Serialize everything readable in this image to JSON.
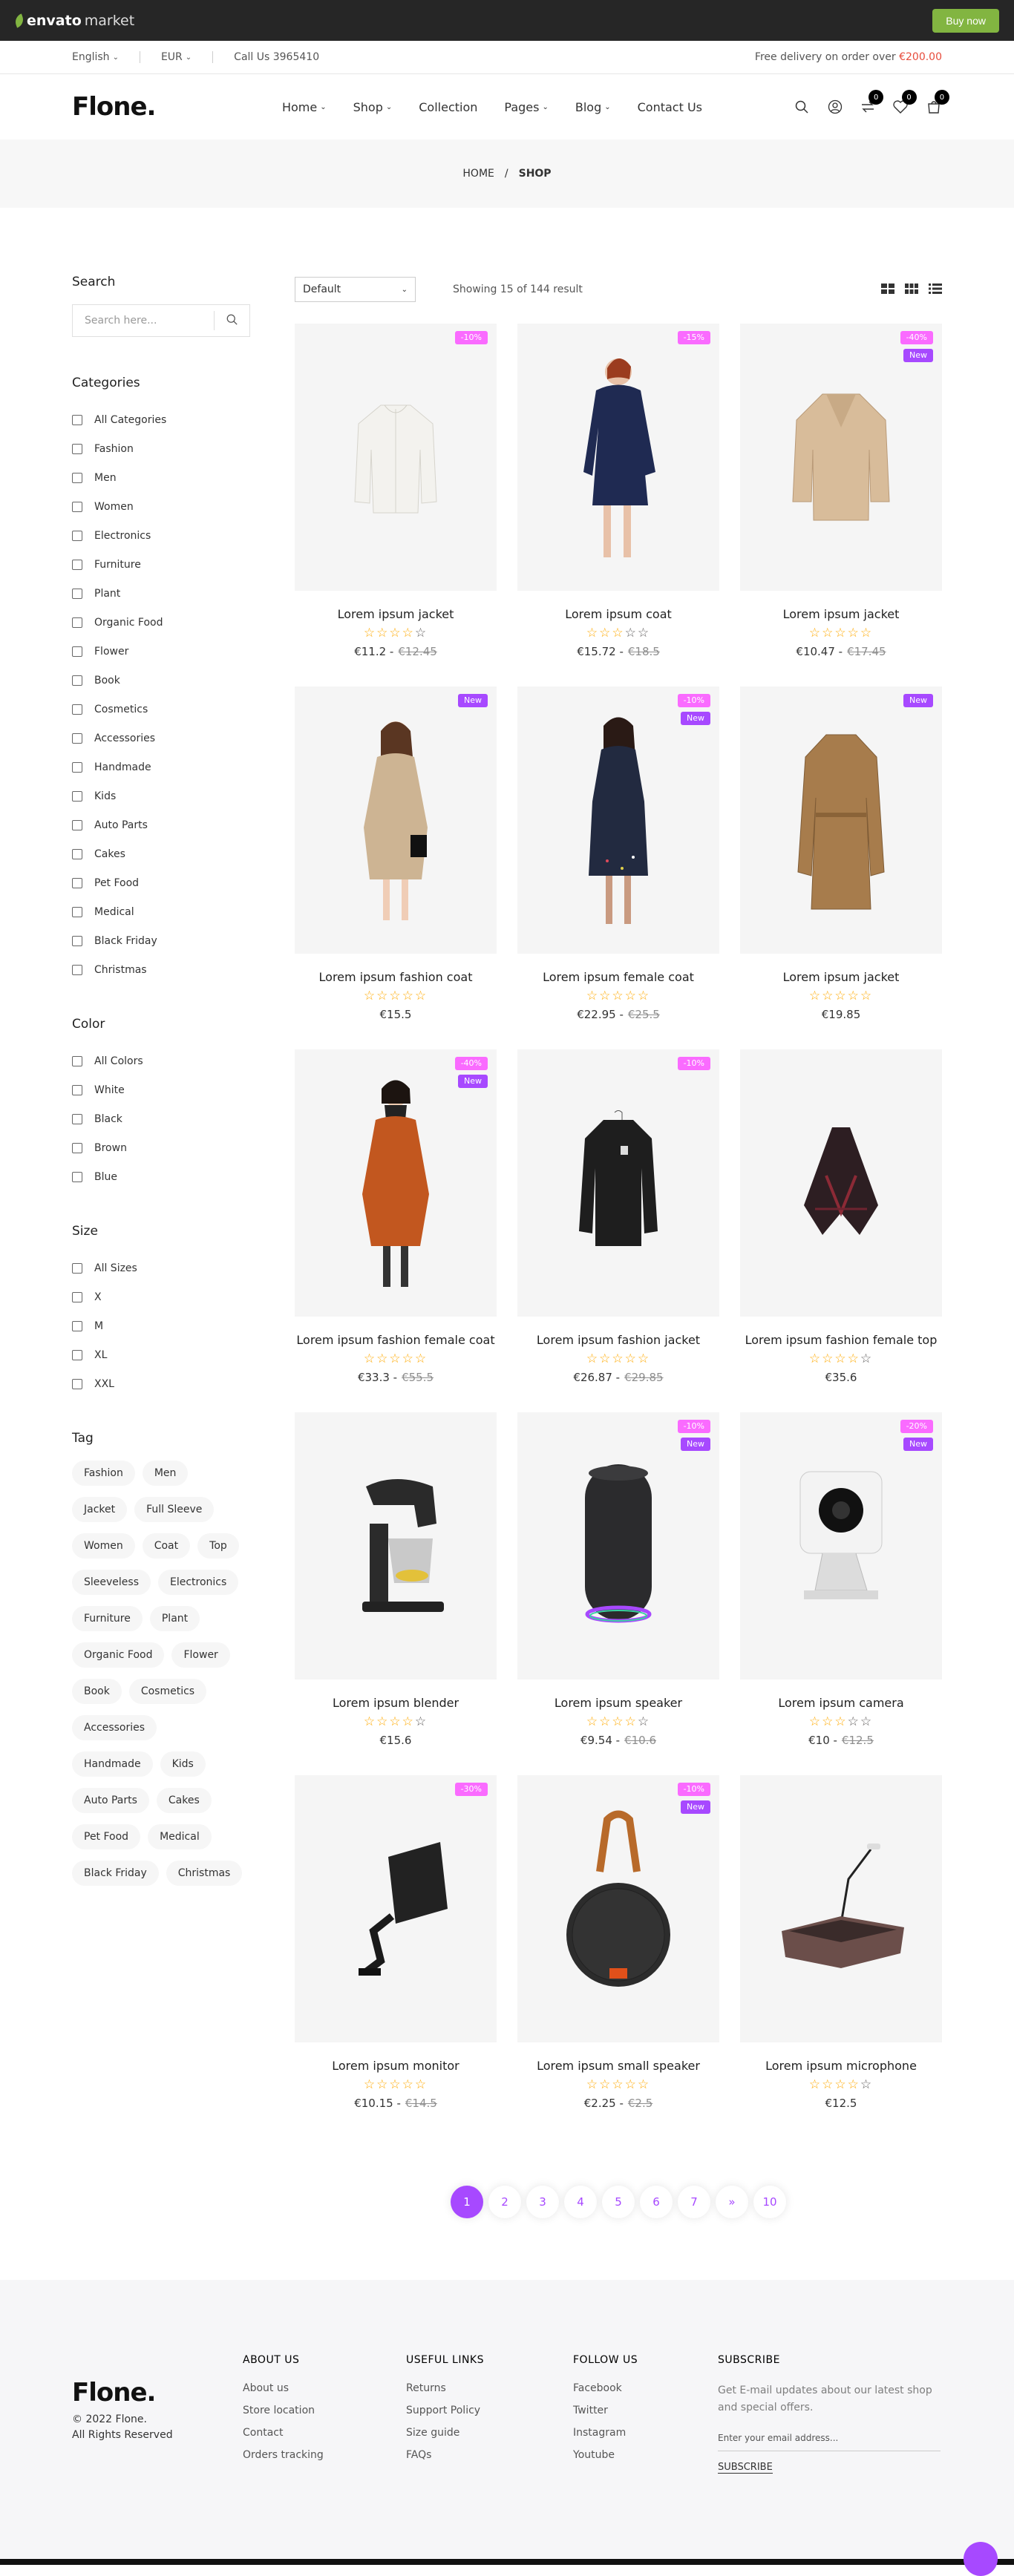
{
  "envato": {
    "logo_a": "envato",
    "logo_b": "market",
    "buy": "Buy now"
  },
  "topbar": {
    "language": "English",
    "currency": "EUR",
    "call": "Call Us 3965410",
    "delivery": "Free delivery on order over ",
    "delivery_amount": "€200.00"
  },
  "header": {
    "logo": "Flone.",
    "nav": [
      "Home",
      "Shop",
      "Collection",
      "Pages",
      "Blog",
      "Contact Us"
    ],
    "compare_count": "0",
    "wishlist_count": "0",
    "cart_count": "0"
  },
  "breadcrumb": {
    "home": "HOME",
    "sep": "/",
    "current": "SHOP"
  },
  "sidebar": {
    "search_title": "Search",
    "search_placeholder": "Search here...",
    "categories_title": "Categories",
    "categories": [
      "All Categories",
      "Fashion",
      "Men",
      "Women",
      "Electronics",
      "Furniture",
      "Plant",
      "Organic Food",
      "Flower",
      "Book",
      "Cosmetics",
      "Accessories",
      "Handmade",
      "Kids",
      "Auto Parts",
      "Cakes",
      "Pet Food",
      "Medical",
      "Black Friday",
      "Christmas"
    ],
    "color_title": "Color",
    "colors": [
      "All Colors",
      "White",
      "Black",
      "Brown",
      "Blue"
    ],
    "size_title": "Size",
    "sizes": [
      "All Sizes",
      "X",
      "M",
      "XL",
      "XXL"
    ],
    "tag_title": "Tag",
    "tags": [
      "Fashion",
      "Men",
      "Jacket",
      "Full Sleeve",
      "Women",
      "Coat",
      "Top",
      "Sleeveless",
      "Electronics",
      "Furniture",
      "Plant",
      "Organic Food",
      "Flower",
      "Book",
      "Cosmetics",
      "Accessories",
      "Handmade",
      "Kids",
      "Auto Parts",
      "Cakes",
      "Pet Food",
      "Medical",
      "Black Friday",
      "Christmas"
    ]
  },
  "toolbar": {
    "sort": "Default",
    "showing": "Showing 15 of 144 result"
  },
  "products": [
    {
      "name": "Lorem ipsum jacket",
      "rating": 4,
      "price": "€11.2 -",
      "old": "€12.45",
      "discount": "-10%",
      "new": false,
      "img": "white-jacket"
    },
    {
      "name": "Lorem ipsum coat",
      "rating": 3,
      "price": "€15.72 -",
      "old": "€18.5",
      "discount": "-15%",
      "new": false,
      "img": "navy-coat"
    },
    {
      "name": "Lorem ipsum jacket",
      "rating": 5,
      "price": "€10.47 -",
      "old": "€17.45",
      "discount": "-40%",
      "new": true,
      "img": "beige-coat"
    },
    {
      "name": "Lorem ipsum fashion coat",
      "rating": 5,
      "price": "€15.5",
      "old": "",
      "discount": "",
      "new": true,
      "img": "trench-woman"
    },
    {
      "name": "Lorem ipsum female coat",
      "rating": 5,
      "price": "€22.95 -",
      "old": "€25.5",
      "discount": "-10%",
      "new": true,
      "img": "black-dress"
    },
    {
      "name": "Lorem ipsum jacket",
      "rating": 5,
      "price": "€19.85",
      "old": "",
      "discount": "",
      "new": true,
      "img": "trench-coat"
    },
    {
      "name": "Lorem ipsum fashion female coat",
      "rating": 5,
      "price": "€33.3 -",
      "old": "€55.5",
      "discount": "-40%",
      "new": true,
      "img": "orange-coat"
    },
    {
      "name": "Lorem ipsum fashion jacket",
      "rating": 5,
      "price": "€26.87 -",
      "old": "€29.85",
      "discount": "-10%",
      "new": false,
      "img": "black-jacket"
    },
    {
      "name": "Lorem ipsum fashion female top",
      "rating": 4,
      "price": "€35.6",
      "old": "",
      "discount": "",
      "new": false,
      "img": "poncho"
    },
    {
      "name": "Lorem ipsum blender",
      "rating": 4,
      "price": "€15.6",
      "old": "",
      "discount": "",
      "new": false,
      "img": "blender"
    },
    {
      "name": "Lorem ipsum speaker",
      "rating": 4,
      "price": "€9.54 -",
      "old": "€10.6",
      "discount": "-10%",
      "new": true,
      "img": "speaker"
    },
    {
      "name": "Lorem ipsum camera",
      "rating": 3,
      "price": "€10 -",
      "old": "€12.5",
      "discount": "-20%",
      "new": true,
      "img": "camera"
    },
    {
      "name": "Lorem ipsum monitor",
      "rating": 5,
      "price": "€10.15 -",
      "old": "€14.5",
      "discount": "-30%",
      "new": false,
      "img": "monitor"
    },
    {
      "name": "Lorem ipsum small speaker",
      "rating": 5,
      "price": "€2.25 -",
      "old": "€2.5",
      "discount": "-10%",
      "new": true,
      "img": "small-speaker"
    },
    {
      "name": "Lorem ipsum microphone",
      "rating": 4,
      "price": "€12.5",
      "old": "",
      "discount": "",
      "new": false,
      "img": "microphone"
    }
  ],
  "new_label": "New",
  "pagination": [
    "1",
    "2",
    "3",
    "4",
    "5",
    "6",
    "7",
    "»",
    "10"
  ],
  "footer": {
    "logo": "Flone.",
    "copy1": "© 2022 Flone.",
    "copy2": "All Rights Reserved",
    "about_title": "ABOUT US",
    "about": [
      "About us",
      "Store location",
      "Contact",
      "Orders tracking"
    ],
    "useful_title": "USEFUL LINKS",
    "useful": [
      "Returns",
      "Support Policy",
      "Size guide",
      "FAQs"
    ],
    "follow_title": "FOLLOW US",
    "follow": [
      "Facebook",
      "Twitter",
      "Instagram",
      "Youtube"
    ],
    "sub_title": "SUBSCRIBE",
    "sub_text": "Get E-mail updates about our latest shop and special offers.",
    "sub_placeholder": "Enter your email address...",
    "sub_button": "SUBSCRIBE"
  },
  "colors": {
    "accent": "#a749ff",
    "discount": "#fa6bff",
    "star": "#ffa900",
    "envato_green": "#82b541"
  }
}
